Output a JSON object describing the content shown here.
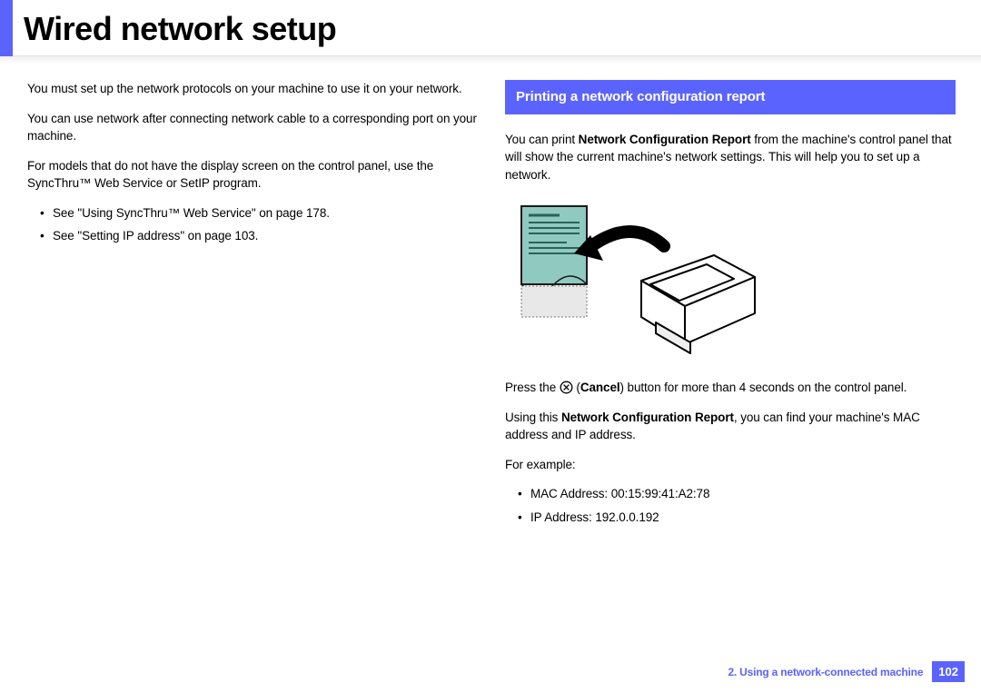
{
  "header": {
    "title": "Wired network setup"
  },
  "left": {
    "p1": "You must set up the network protocols on your machine to use it on your network.",
    "p2": "You can use network after connecting network cable to a corresponding port on your machine.",
    "p3": "For models that do not have the display screen on the control panel, use the SyncThru™ Web Service or SetIP program.",
    "bullets": [
      "See \"Using SyncThru™ Web Service\" on page 178.",
      "See \"Setting IP address\" on page 103."
    ]
  },
  "right": {
    "heading": "Printing a network configuration report",
    "p1_pre": "You can print ",
    "p1_bold": "Network Configuration Report",
    "p1_post": " from the machine's control panel that will show the current machine's network settings. This will help you to set up a network.",
    "press_pre": "Press the ",
    "press_bold": "Cancel",
    "press_post": ") button for more than 4 seconds on the control panel.",
    "p2_pre": "Using this ",
    "p2_bold": "Network Configuration Report",
    "p2_post": ", you can find your machine's MAC address and IP address.",
    "forexample": "For example:",
    "examples": [
      "MAC Address: 00:15:99:41:A2:78",
      "IP Address: 192.0.0.192"
    ]
  },
  "footer": {
    "chapter": "2.  Using a network-connected machine",
    "page": "102"
  }
}
